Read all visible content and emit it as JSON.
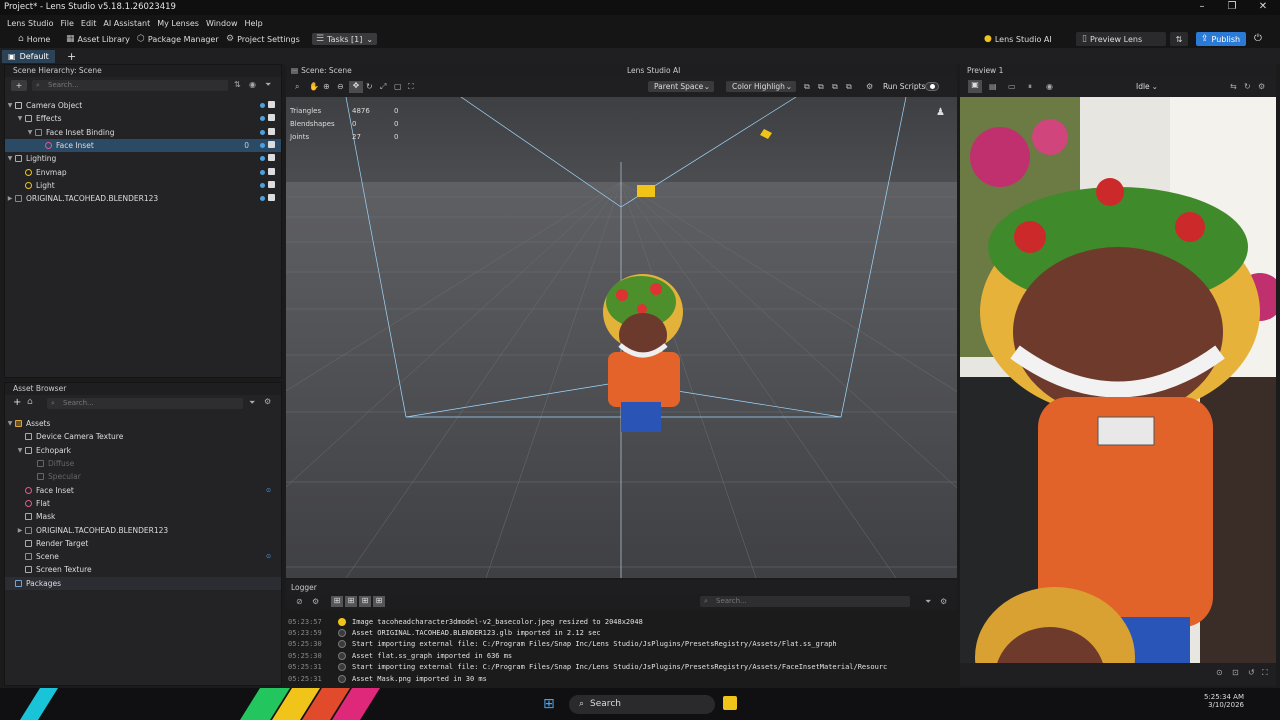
{
  "window": {
    "title": "Project* - Lens Studio v5.18.1.26023419"
  },
  "menu": [
    "Lens Studio",
    "File",
    "Edit",
    "AI Assistant",
    "My Lenses",
    "Window",
    "Help"
  ],
  "toolbar": {
    "home": "Home",
    "asset_library": "Asset Library",
    "package_manager": "Package Manager",
    "project_settings": "Project Settings",
    "tasks": "Tasks [1]",
    "lens_studio_ai": "Lens Studio AI",
    "preview_lens": "Preview Lens",
    "publish": "Publish"
  },
  "layout_tab": "Default",
  "hierarchy": {
    "title": "Scene Hierarchy: Scene",
    "search_placeholder": "Search...",
    "items": [
      {
        "label": "Camera Object",
        "depth": 0
      },
      {
        "label": "Effects",
        "depth": 1
      },
      {
        "label": "Face Inset Binding",
        "depth": 2
      },
      {
        "label": "Face Inset",
        "depth": 3,
        "selected": true,
        "count": "0"
      },
      {
        "label": "Lighting",
        "depth": 0
      },
      {
        "label": "Envmap",
        "depth": 1
      },
      {
        "label": "Light",
        "depth": 1
      },
      {
        "label": "ORIGINAL.TACOHEAD.BLENDER123",
        "depth": 0
      }
    ]
  },
  "assets": {
    "title": "Asset Browser",
    "search_placeholder": "Search...",
    "items": [
      {
        "label": "Assets",
        "depth": 0
      },
      {
        "label": "Device Camera Texture",
        "depth": 1
      },
      {
        "label": "Echopark",
        "depth": 1
      },
      {
        "label": "Diffuse",
        "depth": 2,
        "dim": true
      },
      {
        "label": "Specular",
        "depth": 2,
        "dim": true
      },
      {
        "label": "Face Inset",
        "depth": 1
      },
      {
        "label": "Flat",
        "depth": 1
      },
      {
        "label": "Mask",
        "depth": 1
      },
      {
        "label": "ORIGINAL.TACOHEAD.BLENDER123",
        "depth": 1
      },
      {
        "label": "Render Target",
        "depth": 1
      },
      {
        "label": "Scene",
        "depth": 1
      },
      {
        "label": "Screen Texture",
        "depth": 1
      },
      {
        "label": "Packages",
        "depth": 0
      }
    ]
  },
  "scene": {
    "title": "Scene: Scene",
    "center_label": "Lens Studio AI",
    "parent_space": "Parent Space",
    "color_highlight": "Color Highligh",
    "run_scripts": "Run Scripts",
    "stats": [
      {
        "label": "Triangles",
        "a": "4876",
        "b": "0"
      },
      {
        "label": "Blendshapes",
        "a": "0",
        "b": "0"
      },
      {
        "label": "Joints",
        "a": "27",
        "b": "0"
      }
    ]
  },
  "preview": {
    "title": "Preview 1",
    "state": "Idle"
  },
  "logger": {
    "title": "Logger",
    "search_placeholder": "Search...",
    "lines": [
      {
        "time": "05:23:57",
        "level": "warn",
        "text": "Image tacoheadcharacter3dmodel-v2_basecolor.jpeg resized to 2048x2048"
      },
      {
        "time": "05:23:59",
        "level": "ok",
        "text": "Asset ORIGINAL.TACOHEAD.BLENDER123.glb imported in 2.12 sec"
      },
      {
        "time": "05:25:30",
        "level": "ok",
        "text": "Start importing external file: C:/Program Files/Snap Inc/Lens Studio/JsPlugins/PresetsRegistry/Assets/Flat.ss_graph"
      },
      {
        "time": "05:25:30",
        "level": "ok",
        "text": "Asset flat.ss_graph imported in 636 ms"
      },
      {
        "time": "05:25:31",
        "level": "ok",
        "text": "Start importing external file: C:/Program Files/Snap Inc/Lens Studio/JsPlugins/PresetsRegistry/Assets/FaceInsetMaterial/Resourc"
      },
      {
        "time": "05:25:31",
        "level": "ok",
        "text": "Asset Mask.png imported in 30 ms"
      }
    ]
  },
  "taskbar": {
    "search": "Search",
    "time": "5:25:34 AM",
    "date": "3/10/2026"
  },
  "colors": {
    "accent": "#2a7ad6",
    "selection": "#2b4a66",
    "viewport": "#4a4b4e"
  }
}
